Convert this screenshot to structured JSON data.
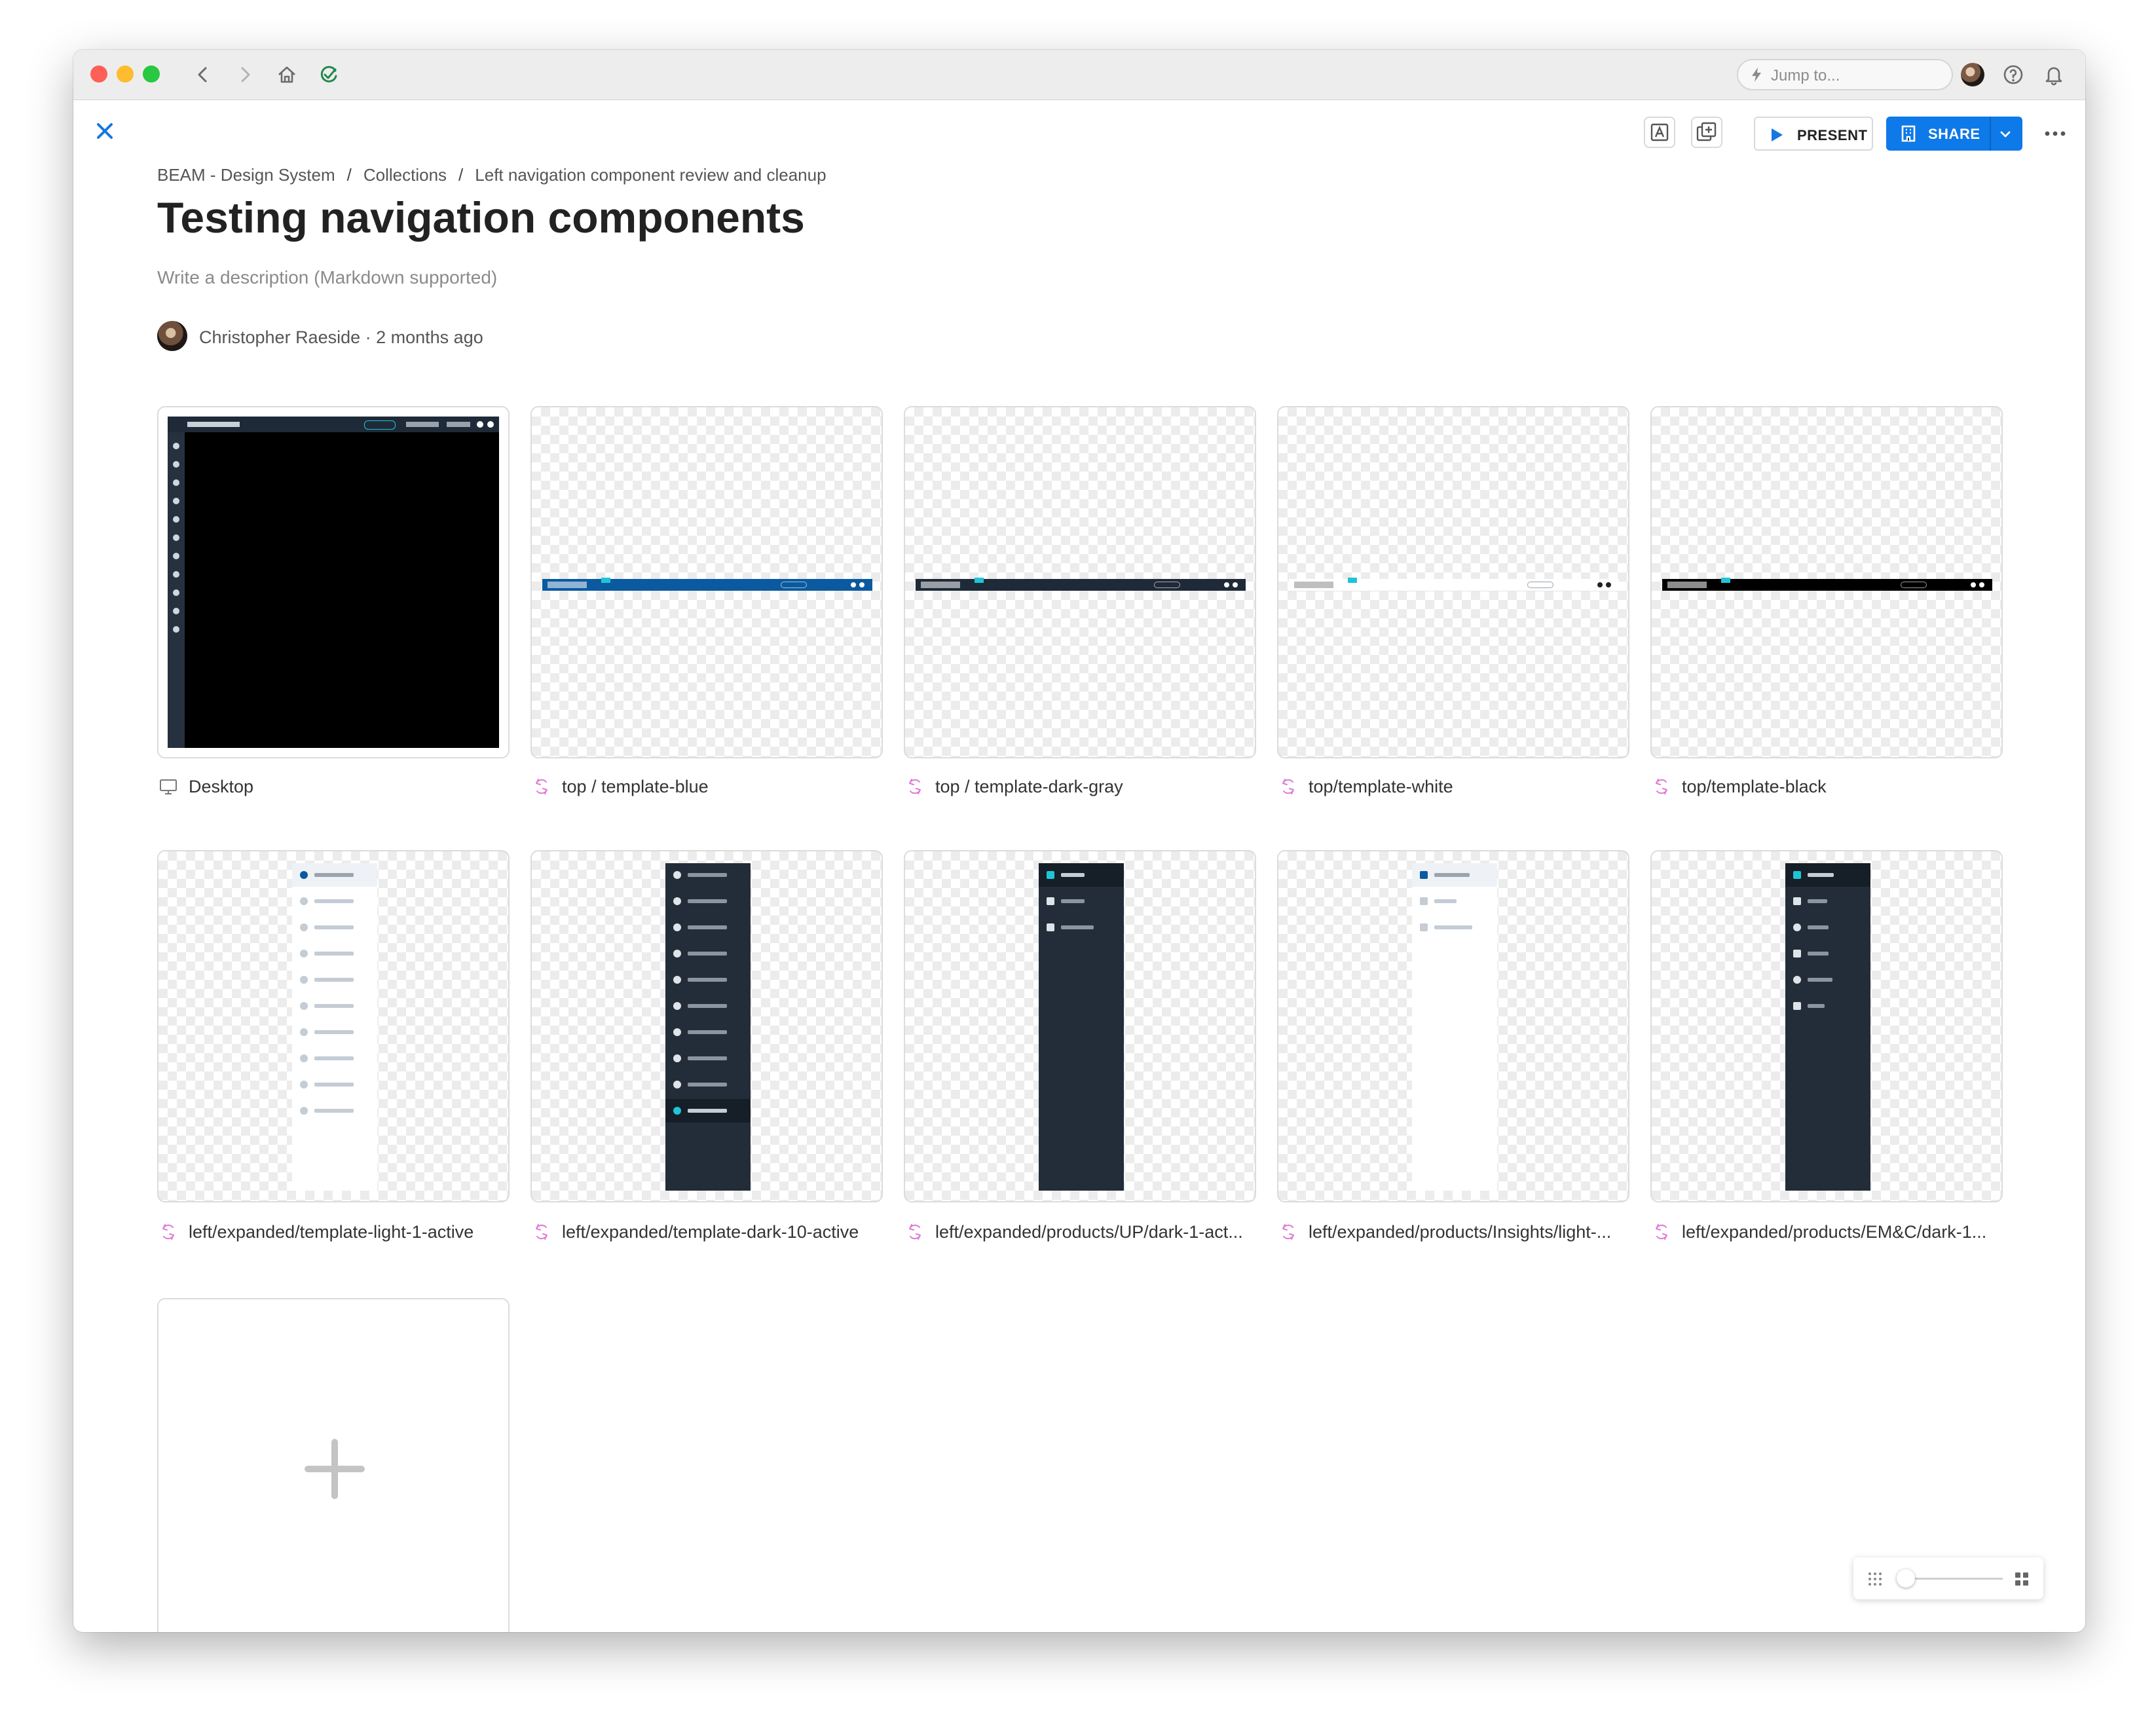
{
  "chrome": {
    "jump_placeholder": "Jump to..."
  },
  "toolbar": {
    "present_label": "PRESENT",
    "share_label": "SHARE"
  },
  "breadcrumb": [
    "BEAM - Design System",
    "Collections",
    "Left navigation component review and cleanup"
  ],
  "page": {
    "title": "Testing navigation components",
    "description_placeholder": "Write a description (Markdown supported)",
    "author": "Christopher Raeside",
    "updated": "2 months ago"
  },
  "cards": [
    {
      "label": "Desktop",
      "icon": "monitor-icon"
    },
    {
      "label": "top / template-blue",
      "icon": "symbol-icon",
      "bar_color": "#0b5aa0"
    },
    {
      "label": "top / template-dark-gray",
      "icon": "symbol-icon",
      "bar_color": "#1f2a38"
    },
    {
      "label": "top/template-white",
      "icon": "symbol-icon",
      "bar_color": "#ffffff"
    },
    {
      "label": "top/template-black",
      "icon": "symbol-icon",
      "bar_color": "#000000"
    },
    {
      "label": "left/expanded/template-light-1-active",
      "icon": "symbol-icon"
    },
    {
      "label": "left/expanded/template-dark-10-active",
      "icon": "symbol-icon"
    },
    {
      "label": "left/expanded/products/UP/dark-1-act...",
      "icon": "symbol-icon"
    },
    {
      "label": "left/expanded/products/Insights/light-...",
      "icon": "symbol-icon"
    },
    {
      "label": "left/expanded/products/EM&C/dark-1...",
      "icon": "symbol-icon"
    }
  ],
  "colors": {
    "accent": "#0e79e8",
    "symbol_icon": "#e07ad8",
    "nav_dark": "#222d39"
  }
}
